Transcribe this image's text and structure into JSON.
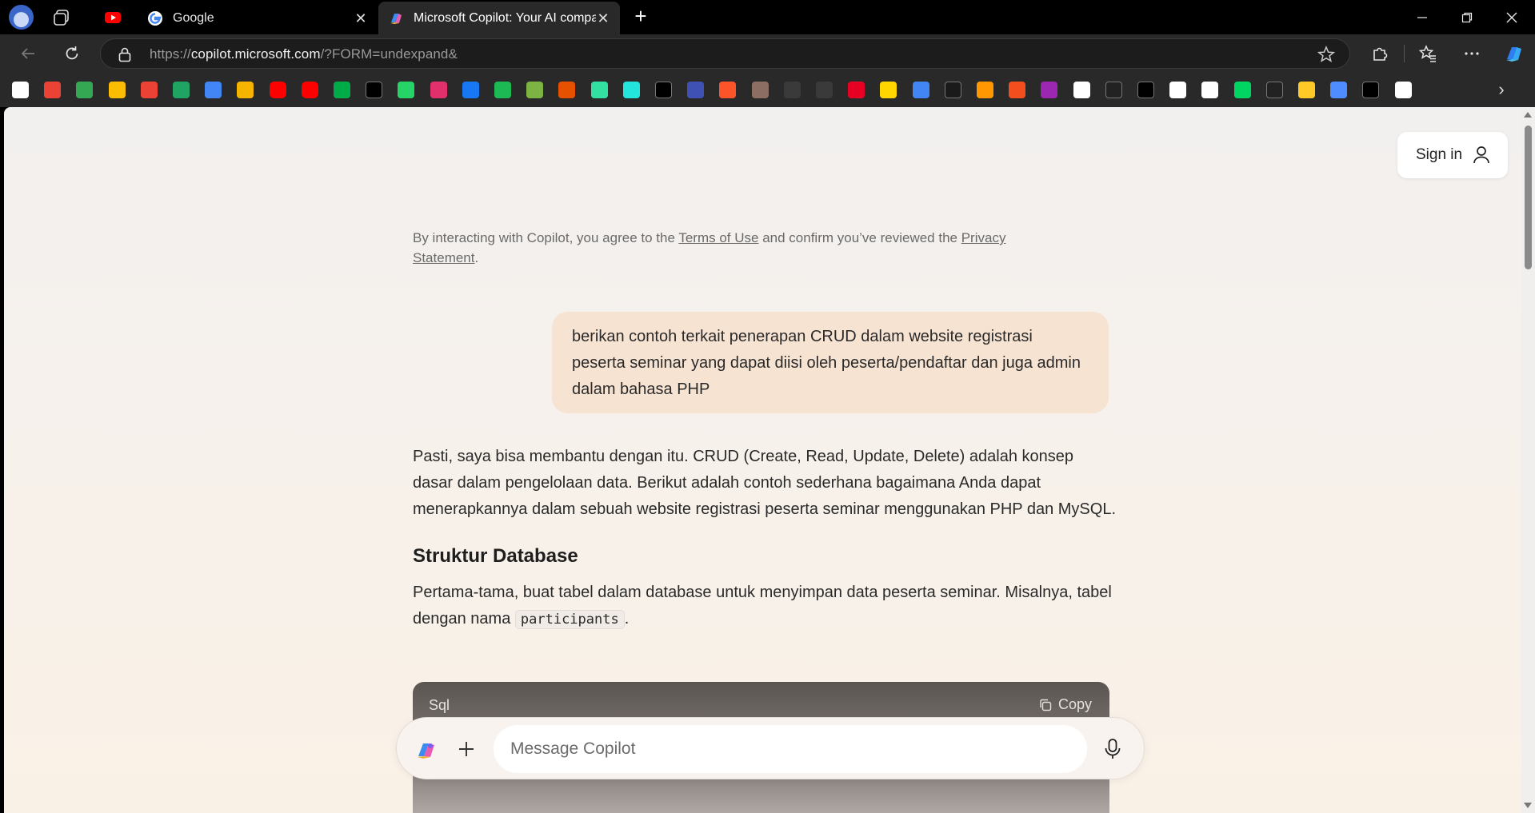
{
  "browser": {
    "tabs": [
      {
        "title": "Google",
        "favicon": "google-g-icon",
        "active": false
      },
      {
        "title": "Microsoft Copilot: Your AI compan",
        "favicon": "copilot-icon",
        "active": true
      }
    ],
    "address": {
      "prefix": "https://",
      "host": "copilot.microsoft.com",
      "path": "/?FORM=undexpand&"
    },
    "favorites": [
      "google-icon",
      "gmail-icon",
      "maps-icon",
      "keep-icon",
      "photos-icon",
      "drive-icon",
      "calendar-icon",
      "slides-icon",
      "youtube-icon",
      "youtube-icon",
      "meet-icon",
      "x-icon",
      "whatsapp-icon",
      "instagram-icon",
      "facebook-icon",
      "spotify-icon",
      "site-icon",
      "shop-icon",
      "tripadvisor-icon",
      "olx-icon",
      "x-alt-icon",
      "forms-icon",
      "brave-icon",
      "avatar-icon",
      "github-icon",
      "github-icon",
      "pinterest-icon",
      "site-icon",
      "translate-icon",
      "prime-icon",
      "site-icon",
      "figma-icon",
      "site-icon",
      "openai-icon",
      "site-icon",
      "tiktok-icon",
      "goodreads-icon",
      "site-icon",
      "webtoon-icon",
      "site-icon",
      "site-icon",
      "gemini-icon",
      "unsplash-icon",
      "threads-icon"
    ],
    "colors": {
      "chrome": "#292929",
      "tabstrip": "#000000"
    }
  },
  "page": {
    "signin_label": "Sign in",
    "terms": {
      "before": "By interacting with Copilot, you agree to the ",
      "terms_link": "Terms of Use",
      "middle": " and confirm you’ve reviewed the ",
      "privacy_link": "Privacy Statement",
      "after": "."
    },
    "user_message": "berikan contoh terkait penerapan CRUD dalam website registrasi peserta seminar yang dapat diisi oleh peserta/pendaftar dan juga admin dalam bahasa PHP",
    "answer": {
      "intro": "Pasti, saya bisa membantu dengan itu. CRUD (Create, Read, Update, Delete) adalah konsep dasar dalam pengelolaan data. Berikut adalah contoh sederhana bagaimana Anda dapat menerapkannya dalam sebuah website registrasi peserta seminar menggunakan PHP dan MySQL.",
      "heading": "Struktur Database",
      "para_before_code": "Pertama-tama, buat tabel dalam database untuk menyimpan data peserta seminar. Misalnya, tabel dengan nama ",
      "inline_code": "participants",
      "para_after_code": "."
    },
    "code_block": {
      "language": "Sql",
      "copy_label": "Copy"
    },
    "composer": {
      "placeholder": "Message Copilot"
    },
    "colors": {
      "user_bubble": "#f7e3d2",
      "background": "#f6f1ec"
    }
  }
}
